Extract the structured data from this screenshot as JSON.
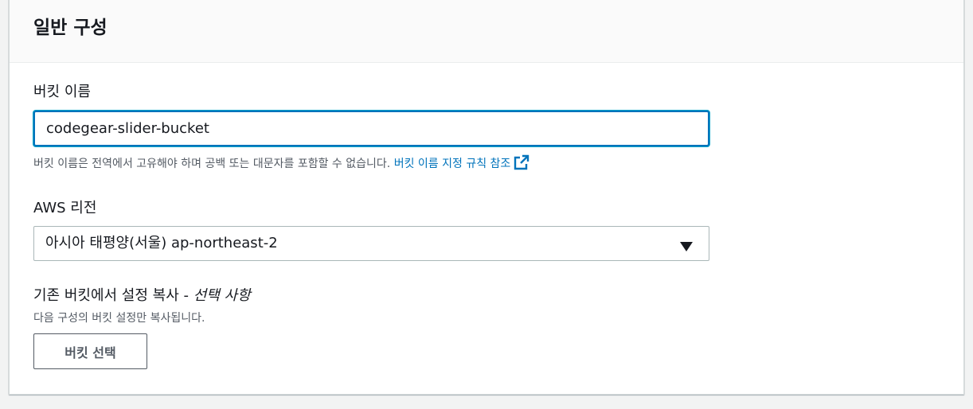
{
  "section": {
    "title": "일반 구성"
  },
  "bucket_name": {
    "label": "버킷 이름",
    "value": "codegear-slider-bucket",
    "hint": "버킷 이름은 전역에서 고유해야 하며 공백 또는 대문자를 포함할 수 없습니다.",
    "hint_link": "버킷 이름 지정 규칙 참조",
    "hint_link_icon": "external-link-icon"
  },
  "region": {
    "label": "AWS 리전",
    "selected": "아시아 태평양(서울) ap-northeast-2",
    "caret_icon": "caret-down-icon"
  },
  "copy_settings": {
    "label": "기존 버킷에서 설정 복사 - ",
    "optional": "선택 사항",
    "description": "다음 구성의 버킷 설정만 복사됩니다.",
    "button_label": "버킷 선택"
  },
  "colors": {
    "link": "#0073bb",
    "focus_border": "#0073bb",
    "text": "#16191f",
    "muted": "#545b64"
  }
}
